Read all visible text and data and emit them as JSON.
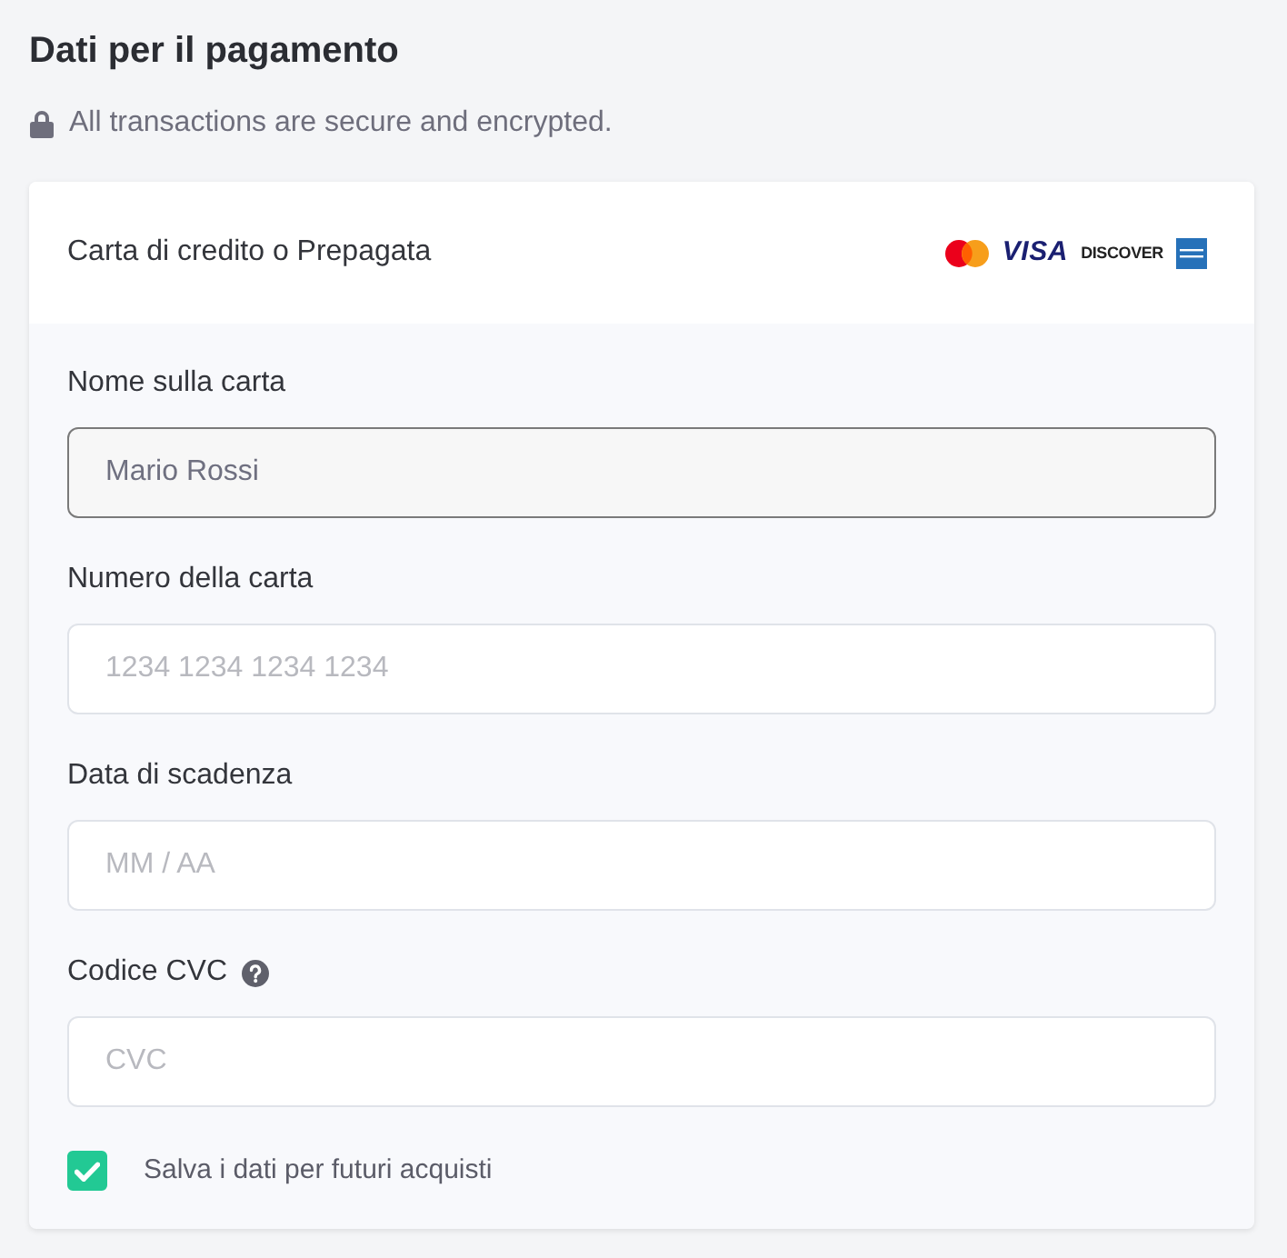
{
  "heading": "Dati per il pagamento",
  "security_note": {
    "text": "All transactions are secure and encrypted."
  },
  "payment_method": {
    "label": "Carta di credito o Prepagata",
    "card_logos": [
      {
        "kind": "circles"
      },
      {
        "kind": "wordmark",
        "text": "VISA"
      },
      {
        "kind": "small_wordmark",
        "text": "DISCOVER"
      },
      {
        "kind": "tile"
      }
    ]
  },
  "fields": [
    {
      "label": "Nome sulla carta",
      "value": "Mario Rossi",
      "focused": true,
      "help": false
    },
    {
      "label": "Numero della carta",
      "placeholder": "1234 1234 1234 1234",
      "focused": false,
      "help": false
    },
    {
      "label": "Data di scadenza",
      "placeholder": "MM / AA",
      "focused": false,
      "help": false
    },
    {
      "label": "Codice CVC",
      "placeholder": "CVC",
      "focused": false,
      "help": true
    }
  ],
  "save_option": {
    "label": "Salva i dati per futuri acquisti",
    "checked": true
  }
}
